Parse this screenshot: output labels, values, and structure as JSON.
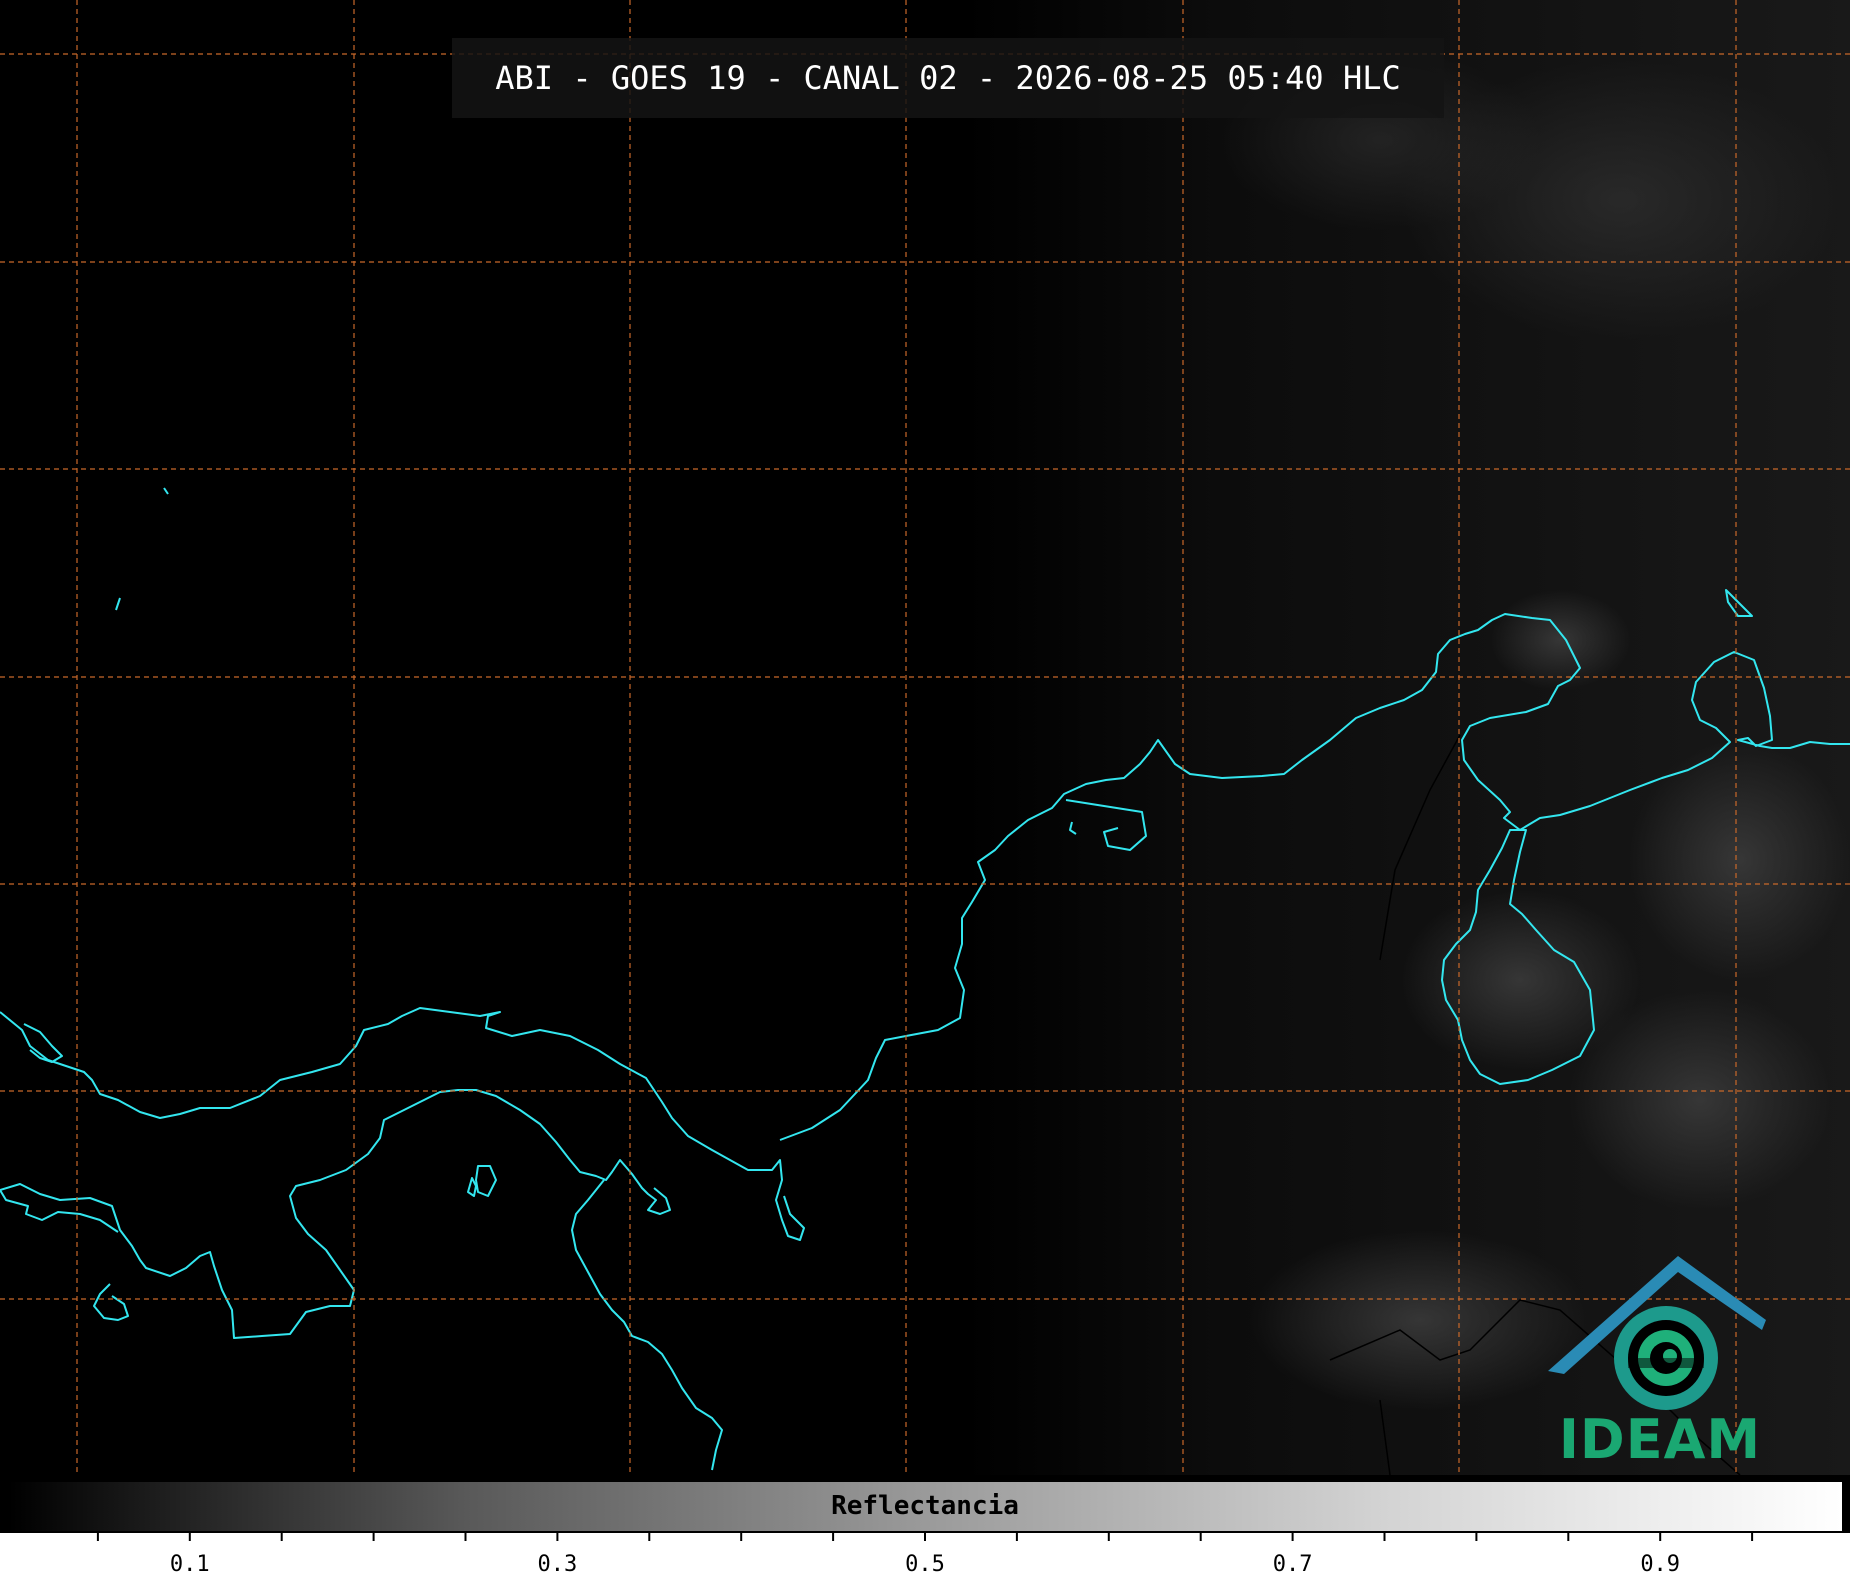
{
  "header": {
    "title": "ABI - GOES 19 - CANAL 02 - 2026-08-25 05:40 HLC"
  },
  "colorbar": {
    "label": "Reflectancia",
    "min": 0.0,
    "max": 1.0,
    "tick_labels": [
      "0.1",
      "0.3",
      "0.5",
      "0.7",
      "0.9"
    ],
    "colormap": [
      "#000000",
      "#595959",
      "#9a9a9a",
      "#d3d3d3",
      "#ffffff"
    ]
  },
  "logo": {
    "text": "IDEAM"
  },
  "colors": {
    "background": "#000000",
    "coastline": "#33e6ef",
    "gridline": "#c8682a",
    "border": "#000000",
    "logo_green": "#1aa872",
    "logo_blue": "#2a66b0"
  },
  "icons": [
    "ideam-logo-icon"
  ]
}
